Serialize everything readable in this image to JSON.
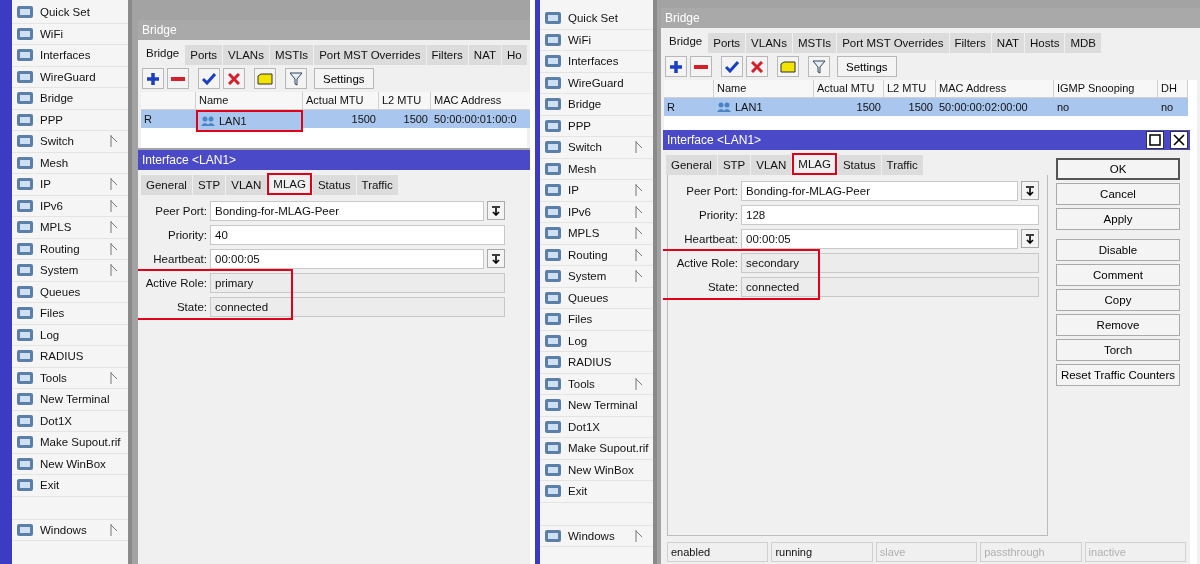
{
  "panes": [
    {
      "menu": [
        {
          "label": "Quick Set",
          "submenu": false
        },
        {
          "label": "WiFi",
          "submenu": false
        },
        {
          "label": "Interfaces",
          "submenu": false
        },
        {
          "label": "WireGuard",
          "submenu": false
        },
        {
          "label": "Bridge",
          "submenu": false
        },
        {
          "label": "PPP",
          "submenu": false
        },
        {
          "label": "Switch",
          "submenu": true
        },
        {
          "label": "Mesh",
          "submenu": false
        },
        {
          "label": "IP",
          "submenu": true
        },
        {
          "label": "IPv6",
          "submenu": true
        },
        {
          "label": "MPLS",
          "submenu": true
        },
        {
          "label": "Routing",
          "submenu": true
        },
        {
          "label": "System",
          "submenu": true
        },
        {
          "label": "Queues",
          "submenu": false
        },
        {
          "label": "Files",
          "submenu": false
        },
        {
          "label": "Log",
          "submenu": false
        },
        {
          "label": "RADIUS",
          "submenu": false
        },
        {
          "label": "Tools",
          "submenu": true
        },
        {
          "label": "New Terminal",
          "submenu": false
        },
        {
          "label": "Dot1X",
          "submenu": false
        },
        {
          "label": "Make Supout.rif",
          "submenu": false
        },
        {
          "label": "New WinBox",
          "submenu": false
        },
        {
          "label": "Exit",
          "submenu": false
        }
      ],
      "windows_item": {
        "label": "Windows",
        "submenu": true
      },
      "bridge": {
        "title": "Bridge",
        "tabs": [
          {
            "label": "Bridge",
            "selected": true
          },
          {
            "label": "Ports",
            "selected": false
          },
          {
            "label": "VLANs",
            "selected": false
          },
          {
            "label": "MSTIs",
            "selected": false
          },
          {
            "label": "Port MST Overrides",
            "selected": false
          },
          {
            "label": "Filters",
            "selected": false
          },
          {
            "label": "NAT",
            "selected": false
          },
          {
            "label": "Ho",
            "selected": false
          }
        ],
        "settings_button": "Settings",
        "columns": [
          "",
          "Name",
          "Actual MTU",
          "L2 MTU",
          "MAC Address"
        ],
        "rows": [
          {
            "cells": [
              "R",
              "LAN1",
              "1500",
              "1500",
              "50:00:00:01:00:0"
            ],
            "name_highlighted": true,
            "selected": true
          }
        ]
      },
      "dialog": {
        "title": "Interface <LAN1>",
        "controls": false,
        "tabs": [
          {
            "label": "General",
            "selected": false,
            "highlighted": false
          },
          {
            "label": "STP",
            "selected": false,
            "highlighted": false
          },
          {
            "label": "VLAN",
            "selected": false,
            "highlighted": false
          },
          {
            "label": "MLAG",
            "selected": true,
            "highlighted": true
          },
          {
            "label": "Status",
            "selected": false,
            "highlighted": false
          },
          {
            "label": "Traffic",
            "selected": false,
            "highlighted": false
          }
        ],
        "fields": [
          {
            "label": "Peer Port:",
            "value": "Bonding-for-MLAG-Peer",
            "kind": "dropdown",
            "highlighted": false
          },
          {
            "label": "Priority:",
            "value": "40",
            "kind": "input",
            "highlighted": false
          },
          {
            "label": "Heartbeat:",
            "value": "00:00:05",
            "kind": "dropdown",
            "highlighted": false
          },
          {
            "label": "Active Role:",
            "value": "primary",
            "kind": "readonly",
            "highlighted": true
          },
          {
            "label": "State:",
            "value": "connected",
            "kind": "readonly",
            "highlighted": true
          }
        ]
      }
    },
    {
      "menu": [
        {
          "label": "Quick Set",
          "submenu": false
        },
        {
          "label": "WiFi",
          "submenu": false
        },
        {
          "label": "Interfaces",
          "submenu": false
        },
        {
          "label": "WireGuard",
          "submenu": false
        },
        {
          "label": "Bridge",
          "submenu": false
        },
        {
          "label": "PPP",
          "submenu": false
        },
        {
          "label": "Switch",
          "submenu": true
        },
        {
          "label": "Mesh",
          "submenu": false
        },
        {
          "label": "IP",
          "submenu": true
        },
        {
          "label": "IPv6",
          "submenu": true
        },
        {
          "label": "MPLS",
          "submenu": true
        },
        {
          "label": "Routing",
          "submenu": true
        },
        {
          "label": "System",
          "submenu": true
        },
        {
          "label": "Queues",
          "submenu": false
        },
        {
          "label": "Files",
          "submenu": false
        },
        {
          "label": "Log",
          "submenu": false
        },
        {
          "label": "RADIUS",
          "submenu": false
        },
        {
          "label": "Tools",
          "submenu": true
        },
        {
          "label": "New Terminal",
          "submenu": false
        },
        {
          "label": "Dot1X",
          "submenu": false
        },
        {
          "label": "Make Supout.rif",
          "submenu": false
        },
        {
          "label": "New WinBox",
          "submenu": false
        },
        {
          "label": "Exit",
          "submenu": false
        }
      ],
      "windows_item": {
        "label": "Windows",
        "submenu": true
      },
      "bridge": {
        "title": "Bridge",
        "tabs": [
          {
            "label": "Bridge",
            "selected": true
          },
          {
            "label": "Ports",
            "selected": false
          },
          {
            "label": "VLANs",
            "selected": false
          },
          {
            "label": "MSTIs",
            "selected": false
          },
          {
            "label": "Port MST Overrides",
            "selected": false
          },
          {
            "label": "Filters",
            "selected": false
          },
          {
            "label": "NAT",
            "selected": false
          },
          {
            "label": "Hosts",
            "selected": false
          },
          {
            "label": "MDB",
            "selected": false
          }
        ],
        "settings_button": "Settings",
        "columns": [
          "",
          "Name",
          "Actual MTU",
          "L2 MTU",
          "MAC Address",
          "IGMP Snooping",
          "DH"
        ],
        "rows": [
          {
            "cells": [
              "R",
              "LAN1",
              "1500",
              "1500",
              "50:00:00:02:00:00",
              "no",
              "no"
            ],
            "name_highlighted": false,
            "selected": true
          }
        ]
      },
      "dialog": {
        "title": "Interface <LAN1>",
        "controls": true,
        "tabs": [
          {
            "label": "General",
            "selected": false,
            "highlighted": false
          },
          {
            "label": "STP",
            "selected": false,
            "highlighted": false
          },
          {
            "label": "VLAN",
            "selected": false,
            "highlighted": false
          },
          {
            "label": "MLAG",
            "selected": true,
            "highlighted": true
          },
          {
            "label": "Status",
            "selected": false,
            "highlighted": false
          },
          {
            "label": "Traffic",
            "selected": false,
            "highlighted": false
          }
        ],
        "fields": [
          {
            "label": "Peer Port:",
            "value": "Bonding-for-MLAG-Peer",
            "kind": "dropdown",
            "highlighted": false
          },
          {
            "label": "Priority:",
            "value": "128",
            "kind": "input",
            "highlighted": false
          },
          {
            "label": "Heartbeat:",
            "value": "00:00:05",
            "kind": "dropdown",
            "highlighted": false
          },
          {
            "label": "Active Role:",
            "value": "secondary",
            "kind": "readonly",
            "highlighted": true
          },
          {
            "label": "State:",
            "value": "connected",
            "kind": "readonly",
            "highlighted": true
          }
        ],
        "buttons": [
          {
            "label": "OK",
            "default": true
          },
          {
            "label": "Cancel",
            "default": false
          },
          {
            "label": "Apply",
            "default": false
          },
          {
            "label": "Disable",
            "default": false
          },
          {
            "label": "Comment",
            "default": false
          },
          {
            "label": "Copy",
            "default": false
          },
          {
            "label": "Remove",
            "default": false
          },
          {
            "label": "Torch",
            "default": false
          },
          {
            "label": "Reset Traffic Counters",
            "default": false
          }
        ],
        "status_bar": [
          {
            "text": "enabled",
            "disabled": false
          },
          {
            "text": "running",
            "disabled": false
          },
          {
            "text": "slave",
            "disabled": true
          },
          {
            "text": "passthrough",
            "disabled": true
          },
          {
            "text": "inactive",
            "disabled": true
          }
        ]
      }
    }
  ]
}
